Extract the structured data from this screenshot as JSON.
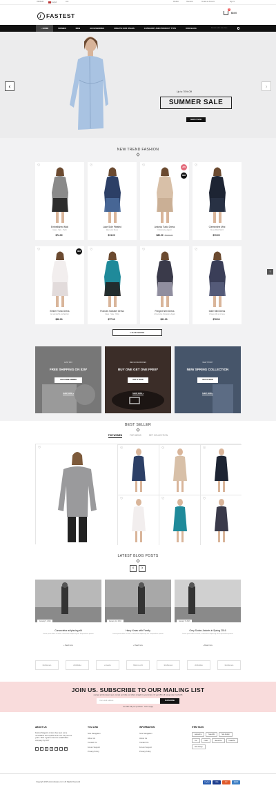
{
  "topbar": {
    "currency": "USD/EUR",
    "language": "English",
    "link": "Link",
    "wishlist": "Wishlist",
    "checkout": "Checkout",
    "account": "Create an Account",
    "signin": "Sign In"
  },
  "header": {
    "logo": "FASTEST",
    "tagline": "Responsive Magento Theme",
    "cart_count": "0",
    "cart_total": "$0.00"
  },
  "nav": {
    "items": [
      "HOME",
      "WOMEN",
      "MEN",
      "ACCESSORIES",
      "CREATE OUR PAGES",
      "CATEGORY AND PRODUCT TYPE",
      "OUR BLOG"
    ],
    "search_placeholder": "Search entire store here"
  },
  "hero": {
    "upto": "Up to 70% Off",
    "title": "SUMMER SALE",
    "button": "SHOP IT NOW"
  },
  "trend": {
    "title": "NEW TREND FASHION",
    "load_more": "LOAD MORE"
  },
  "products": [
    {
      "name": "Embellished Midi",
      "sub": "Ideas · Sale · Hello",
      "price": "$74.00",
      "old": ""
    },
    {
      "name": "Lace Side Pleated",
      "sub": "Elements Dress",
      "price": "$74.00",
      "old": ""
    },
    {
      "name": "Antonia Tunic Dress",
      "sub": "Fabulously elegant",
      "price": "$80.00",
      "old": "$100.00",
      "badge": "-20%",
      "badge2": "NEW"
    },
    {
      "name": "Clementine Mini",
      "sub": "Dress Work Stitch",
      "price": "$70.00",
      "old": ""
    },
    {
      "name": "Ember Tunic Dress",
      "sub": "An wonderful and fashion",
      "price": "$88.00",
      "old": "",
      "badge": "NEW"
    },
    {
      "name": "Frances Sweater Dress",
      "sub": "Ideas · Sale · Hello",
      "price": "$77.00",
      "old": ""
    },
    {
      "name": "Fringed hem Dress",
      "sub": "A Favourite Occasions Again",
      "price": "$91.00",
      "old": ""
    },
    {
      "name": "Indie Mini Dress",
      "sub": "A New with an is here",
      "price": "$78.00",
      "old": ""
    }
  ],
  "promos": [
    {
      "kicker": "LAST DAY",
      "title": "FREE SHIPPING ON $25*",
      "button": "USE CODE JSR839",
      "link": "SHOP NOW »"
    },
    {
      "kicker": "MEN ACCESSORIES",
      "title": "BUY ONE GET ONE FREE*",
      "button": "GET IT NOW",
      "link": "SHOP NOW »"
    },
    {
      "kicker": "NEW STORY",
      "title": "NEW SPRING COLLECTION",
      "button": "GET IT NOW",
      "link": "SHOP NOW »"
    }
  ],
  "bestseller": {
    "title": "BEST SELLER",
    "tabs": [
      "FOR WOMEN",
      "FOR MENS",
      "SET COLLECTION"
    ]
  },
  "blog": {
    "title": "LATEST BLOG POSTS",
    "posts": [
      {
        "title": "Consectetur adipiscing elit",
        "date": "January 5, 2016",
        "excerpt": "Lorem ipsum dolor sit amet, consectetur adipiscing elit. Suspendisse potenti.",
        "read": "+ Read more"
      },
      {
        "title": "Hurry Xmas with Family",
        "date": "January 12, 2016",
        "excerpt": "Lorem ipsum dolor sit amet, consectetur adipiscing elit. Suspendisse potenti.",
        "read": "+ Read more"
      },
      {
        "title": "Grey Sodas Jackets in Spring 2016",
        "date": "January 5, 2016",
        "excerpt": "Lorem ipsum dolor sit amet, consectetur adipiscing elit. Suspendisse potenti.",
        "read": "+ Read more"
      }
    ]
  },
  "brands": [
    "Boflexen",
    "dribbble",
    "envato",
    "Microsoft",
    "Boflexen",
    "dribbble",
    "Boflexen"
  ],
  "newsletter": {
    "title": "JOIN US. SUBSCRIBE TO OUR MAILING LIST",
    "sub": "and get all the latest news, trends and offs and offers straight to your inbox. Or get 15% off using code FLASH15",
    "placeholder": "Your email address",
    "button": "SUBSCRIBE",
    "note": "Get 15% Off your purchase · T&C's apply"
  },
  "footer": {
    "about": {
      "title": "ABOUT US",
      "text": "Fastest Magento 2 store has seen some remarkable accomplishments over the past 10 years. With a goal to become an $8 billion company by 2017"
    },
    "you_link": {
      "title": "YOU LINK",
      "items": [
        "Size Navigation",
        "About Us",
        "Contact Us",
        "Forum Support",
        "Privacy Policy"
      ]
    },
    "information": {
      "title": "INFORMATION",
      "items": [
        "Size Navigation",
        "About Us",
        "Contact Us",
        "Forum Support",
        "Privacy Policy"
      ]
    },
    "tags": {
      "title": "ITEM TAGS",
      "items": [
        "awesome",
        "beautiful",
        "fast design",
        "css",
        "mass",
        "awesome",
        "beautiful",
        "fast design"
      ]
    },
    "social": [
      "f",
      "t",
      "g",
      "p",
      "in",
      "v",
      "rss"
    ]
  },
  "copyright": "Copyright 2015 www.todasan.com / All Rights Reserved",
  "payments": [
    {
      "name": "PayPal",
      "color": "#2a5db0"
    },
    {
      "name": "VISA",
      "color": "#1a3b8c"
    },
    {
      "name": "MC",
      "color": "#e0592a"
    },
    {
      "name": "AMEX",
      "color": "#3d7fc4"
    }
  ]
}
